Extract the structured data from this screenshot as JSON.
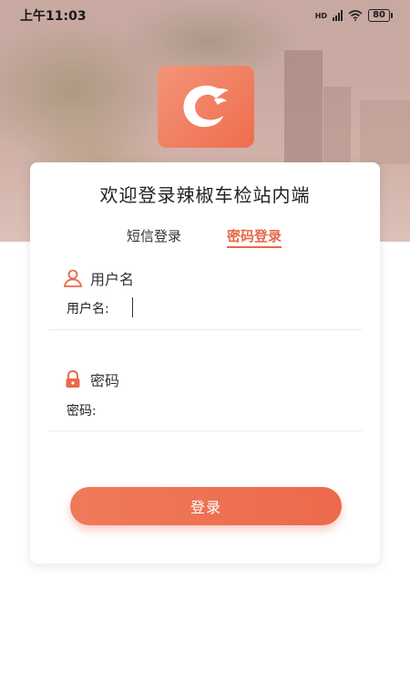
{
  "status_bar": {
    "time": "上午11:03",
    "network": "HD",
    "battery": "80"
  },
  "logo": {
    "icon": "chili-c-logo-icon"
  },
  "card": {
    "title": "欢迎登录辣椒车检站内端",
    "tabs": [
      {
        "label": "短信登录",
        "active": false
      },
      {
        "label": "密码登录",
        "active": true
      }
    ],
    "username": {
      "heading": "用户名",
      "label": "用户名:",
      "value": "",
      "icon": "user-icon"
    },
    "password": {
      "heading": "密码",
      "label": "密码:",
      "value": "",
      "icon": "lock-icon"
    },
    "login_button": "登录"
  },
  "colors": {
    "accent": "#e7694b",
    "button": "#ec6a4b"
  }
}
